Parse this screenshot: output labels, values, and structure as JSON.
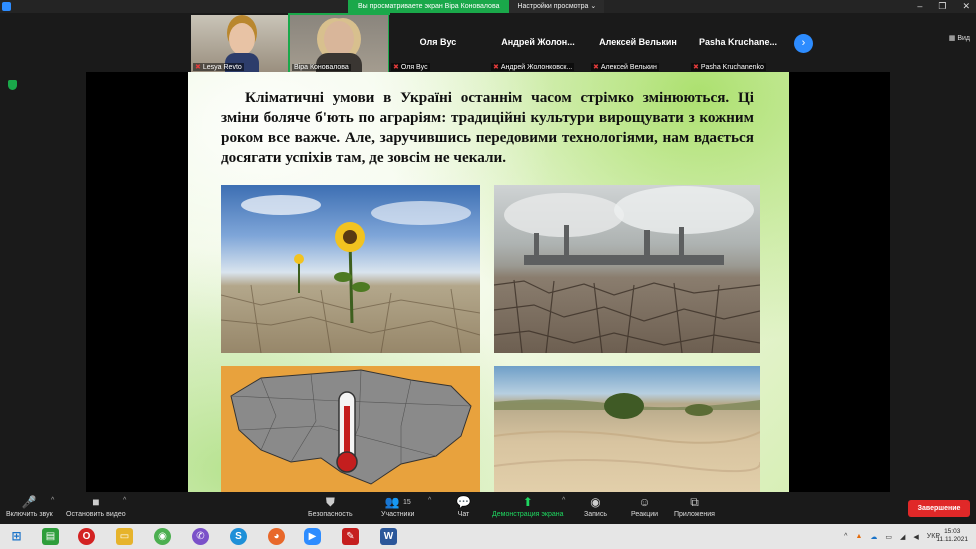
{
  "titlebar": {
    "share_notice": "Вы просматриваете экран Віра Коновалова",
    "view_options": "Настройки просмотра ⌄",
    "minimize": "–",
    "restore": "❐",
    "close": "✕"
  },
  "participants": [
    {
      "label": "Lesya Revto",
      "has_video": true,
      "muted": true
    },
    {
      "label": "Віра Коновалова",
      "has_video": true,
      "muted": false
    },
    {
      "name": "Оля Вус",
      "label": "Оля Вус",
      "has_video": false,
      "muted": true
    },
    {
      "name": "Андрей Жолон...",
      "label": "Андрей Жолонковск...",
      "has_video": false,
      "muted": true
    },
    {
      "name": "Алексей Велькин",
      "label": "Алексей Велькин",
      "has_video": false,
      "muted": true
    },
    {
      "name": "Pasha Kruchane...",
      "label": "Pasha Kruchanenko",
      "has_video": false,
      "muted": true
    }
  ],
  "strip": {
    "next": "›",
    "view_label": "▦ Вид"
  },
  "slide": {
    "text": "Кліматичні умови в Україні останнім часом стрімко змінюються. Ці зміни боляче б'ють по аграріям: традиційні культури вирощувати з кожним роком все важче. Але, заручившись передовими технологіями, нам вдається досягати успіхів там, де зовсім не чекали."
  },
  "toolbar": {
    "audio": {
      "icon": "🎤",
      "label": "Включить звук"
    },
    "video": {
      "icon": "■",
      "label": "Остановить видео"
    },
    "security": {
      "icon": "⛊",
      "label": "Безопасность"
    },
    "participants": {
      "icon": "👥",
      "count": "15",
      "label": "Участники"
    },
    "chat": {
      "icon": "💬",
      "label": "Чат"
    },
    "share": {
      "icon": "⬆",
      "label": "Демонстрация экрана"
    },
    "record": {
      "icon": "◉",
      "label": "Запись"
    },
    "reactions": {
      "icon": "☺",
      "label": "Реакции"
    },
    "apps": {
      "icon": "⧉",
      "label": "Приложения"
    },
    "end": "Завершение",
    "caret": "^"
  },
  "taskbar": {
    "lang": "УКР",
    "time": "15:03",
    "date": "11.11.2021"
  },
  "colors": {
    "zoom_blue": "#2d8cff",
    "share_green": "#1aa84a",
    "end_red": "#e02828"
  }
}
